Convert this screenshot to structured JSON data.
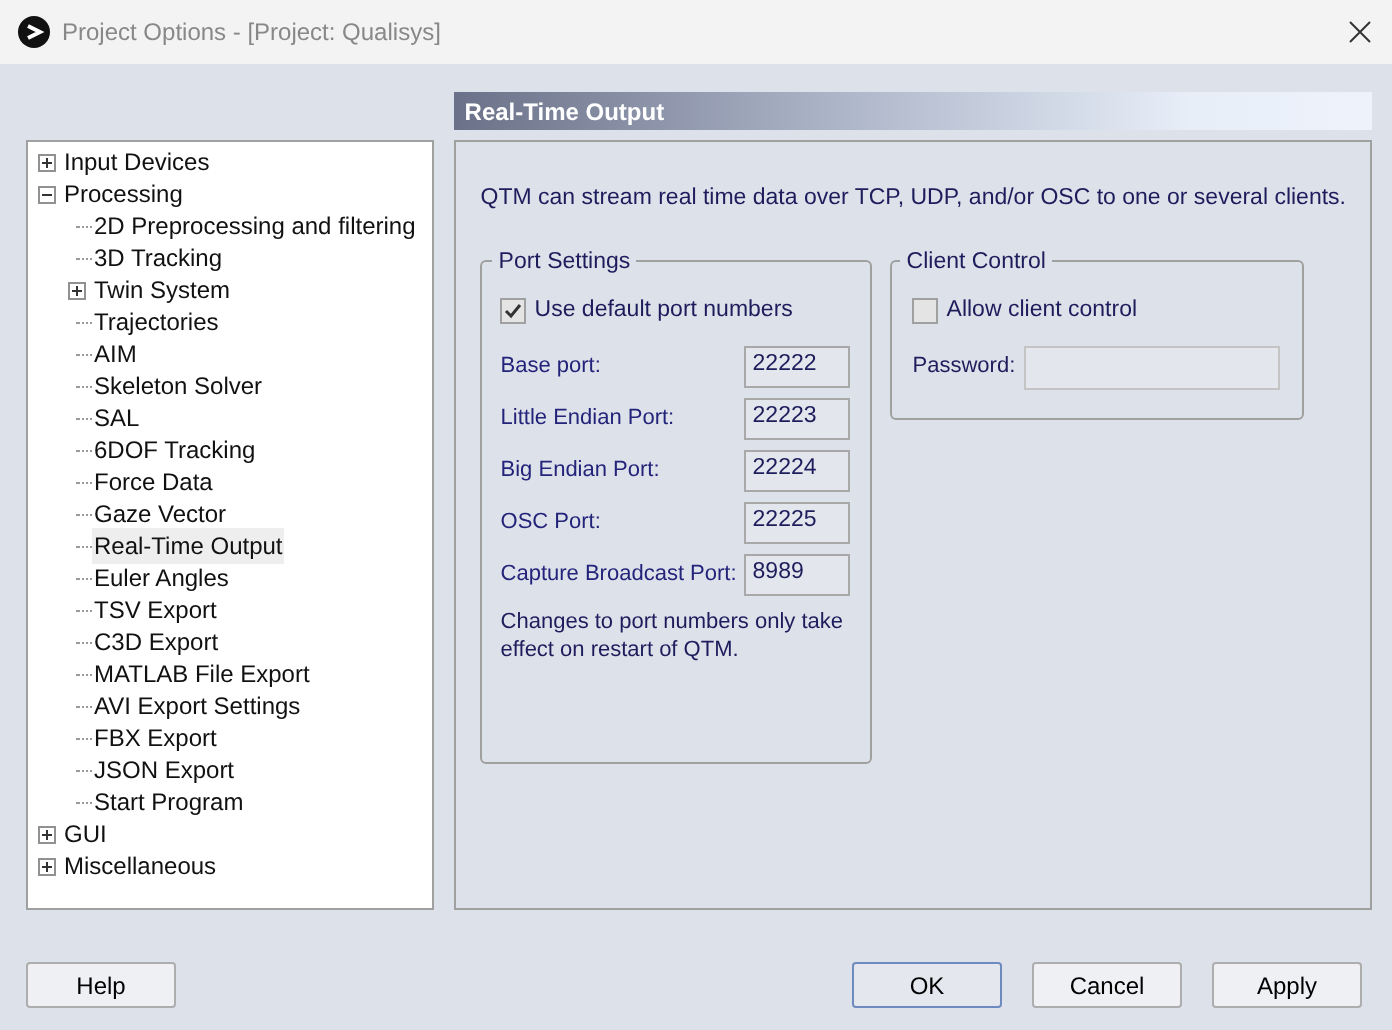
{
  "window": {
    "title": "Project Options - [Project: Qualisys]"
  },
  "tree": [
    {
      "label": "Input Devices",
      "expanded": false,
      "selected": false
    },
    {
      "label": "Processing",
      "expanded": true,
      "selected": false,
      "children": [
        {
          "label": "2D Preprocessing and filtering",
          "selected": false
        },
        {
          "label": "3D Tracking",
          "selected": false
        },
        {
          "label": "Twin System",
          "expanded": false,
          "selected": false
        },
        {
          "label": "Trajectories",
          "selected": false
        },
        {
          "label": "AIM",
          "selected": false
        },
        {
          "label": "Skeleton Solver",
          "selected": false
        },
        {
          "label": "SAL",
          "selected": false
        },
        {
          "label": "6DOF Tracking",
          "selected": false
        },
        {
          "label": "Force Data",
          "selected": false
        },
        {
          "label": "Gaze Vector",
          "selected": false
        },
        {
          "label": "Real-Time Output",
          "selected": true
        },
        {
          "label": "Euler Angles",
          "selected": false
        },
        {
          "label": "TSV Export",
          "selected": false
        },
        {
          "label": "C3D Export",
          "selected": false
        },
        {
          "label": "MATLAB File Export",
          "selected": false
        },
        {
          "label": "AVI Export Settings",
          "selected": false
        },
        {
          "label": "FBX Export",
          "selected": false
        },
        {
          "label": "JSON Export",
          "selected": false
        },
        {
          "label": "Start Program",
          "selected": false
        }
      ]
    },
    {
      "label": "GUI",
      "expanded": false,
      "selected": false
    },
    {
      "label": "Miscellaneous",
      "expanded": false,
      "selected": false
    }
  ],
  "page": {
    "title": "Real-Time Output",
    "description": "QTM can stream real time data over TCP, UDP, and/or OSC to one or several clients.",
    "port_settings": {
      "title": "Port Settings",
      "use_default": {
        "label": "Use default port numbers",
        "checked": true
      },
      "ports": [
        {
          "label": "Base port:",
          "value": "22222"
        },
        {
          "label": "Little Endian Port:",
          "value": "22223"
        },
        {
          "label": "Big Endian Port:",
          "value": "22224"
        },
        {
          "label": "OSC Port:",
          "value": "22225"
        },
        {
          "label": "Capture Broadcast Port:",
          "value": "8989"
        }
      ],
      "note": "Changes to port numbers only take effect on restart of QTM."
    },
    "client_control": {
      "title": "Client Control",
      "allow": {
        "label": "Allow client control",
        "checked": false
      },
      "password_label": "Password:"
    }
  },
  "buttons": {
    "help": "Help",
    "ok": "OK",
    "cancel": "Cancel",
    "apply": "Apply"
  }
}
